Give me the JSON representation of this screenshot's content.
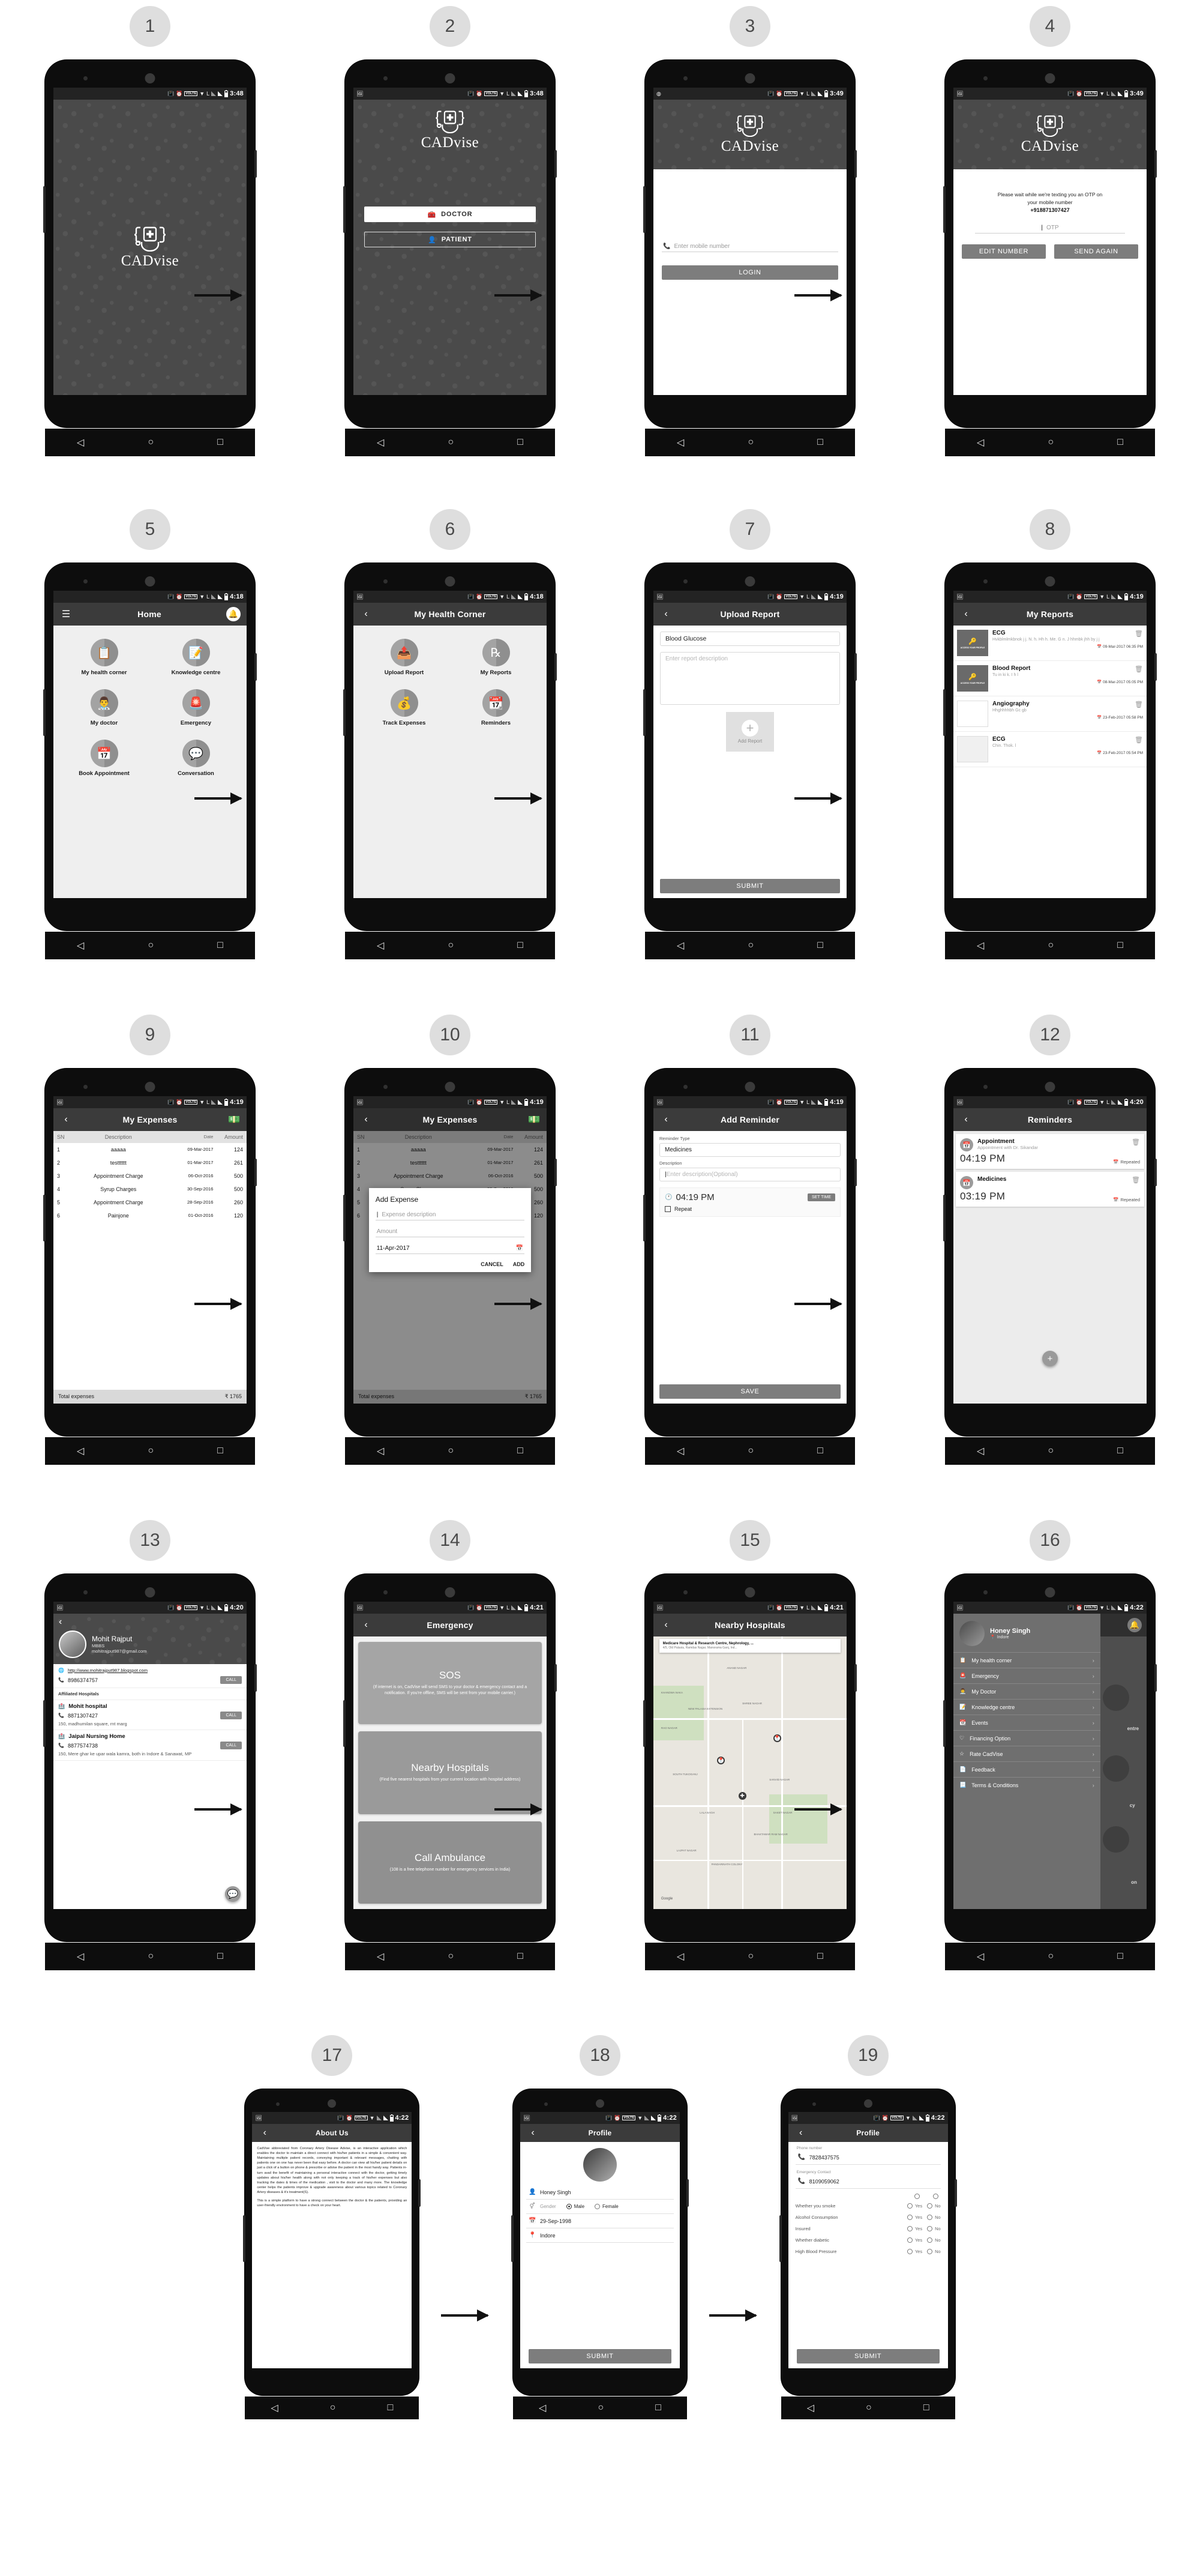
{
  "app": {
    "name": "CADvise",
    "brand_color": "#3b3b3b",
    "accent_grey": "#7d7d7d"
  },
  "steps": [
    "1",
    "2",
    "3",
    "4",
    "5",
    "6",
    "7",
    "8",
    "9",
    "10",
    "11",
    "12",
    "13",
    "14",
    "15",
    "16",
    "17",
    "18",
    "19"
  ],
  "status_bar": {
    "time_348": "3:48",
    "time_349": "3:49",
    "time_418": "4:18",
    "time_419": "4:19",
    "time_420": "4:20",
    "time_421": "4:21",
    "time_422": "4:22",
    "volte": "VOLTE"
  },
  "screen1": {
    "logo_text": "CADvise",
    "time": "3:48"
  },
  "screen2": {
    "time": "3:48",
    "logo_text": "CADvise",
    "doctor_label": "DOCTOR",
    "patient_label": "PATIENT"
  },
  "screen3": {
    "time": "3:49",
    "logo_text": "CADvise",
    "mobile_placeholder": "Enter mobile number",
    "login_label": "LOGIN"
  },
  "screen4": {
    "time": "3:49",
    "logo_text": "CADvise",
    "message_line1": "Please wait while we're texting you an OTP on",
    "message_line2": "your mobile number",
    "phone_number": "+918871307427",
    "otp_placeholder": "OTP",
    "edit_number_label": "EDIT NUMBER",
    "send_again_label": "SEND AGAIN"
  },
  "screen5": {
    "time": "4:18",
    "title": "Home",
    "tiles": [
      {
        "label": "My health corner",
        "icon": "clipboard-heart-icon"
      },
      {
        "label": "Knowledge centre",
        "icon": "document-pencil-icon"
      },
      {
        "label": "My doctor",
        "icon": "doctor-icon"
      },
      {
        "label": "Emergency",
        "icon": "siren-icon"
      },
      {
        "label": "Book Appointment",
        "icon": "calendar-check-icon"
      },
      {
        "label": "Conversation",
        "icon": "chat-bubbles-icon"
      }
    ]
  },
  "screen6": {
    "time": "4:18",
    "title": "My Health Corner",
    "tiles": [
      {
        "label": "Upload Report",
        "icon": "file-upload-icon"
      },
      {
        "label": "My Reports",
        "icon": "prescription-icon"
      },
      {
        "label": "Track Expenses",
        "icon": "money-bag-icon"
      },
      {
        "label": "Reminders",
        "icon": "calendar-icon"
      }
    ]
  },
  "screen7": {
    "time": "4:19",
    "title": "Upload Report",
    "report_type": "Blood Glucose",
    "description_placeholder": "Enter report description",
    "add_report_label": "Add Report",
    "submit_label": "SUBMIT"
  },
  "screen8": {
    "time": "4:19",
    "title": "My Reports",
    "thumb_caption": "ACCESS YOUR PROFILE",
    "thumb_sub": "Lorem ipsum dolor sit er elit lamet, consectetaur cillium adipisicing pecu, sed do eiusmod tempor incididunt ut labore et dolore mag...",
    "reports": [
      {
        "title": "ECG",
        "desc": "Hvkblmlmkbnok j j. N. h. Hh h. Me. G n. J hhmbk jhh by j j",
        "datetime": "09-Mar-2017 06:35 PM",
        "thumb": "dark"
      },
      {
        "title": "Blood Report",
        "desc": "Tu in ki k. I h l",
        "datetime": "08-Mar-2017 05:05 PM",
        "thumb": "dark"
      },
      {
        "title": "Angiography",
        "desc": "Hhghhhhbh Gc gb",
        "datetime": "23-Feb-2017 05:58 PM",
        "thumb": "empty"
      },
      {
        "title": "ECG",
        "desc": "Chin.  Thok. l",
        "datetime": "23-Feb-2017 05:54 PM",
        "thumb": "map"
      }
    ]
  },
  "screen9": {
    "time": "4:19",
    "title": "My Expenses",
    "columns": [
      "SN",
      "Description",
      "Date",
      "Amount"
    ],
    "rows": [
      {
        "sn": "1",
        "desc": "aaaaa",
        "date": "09-Mar-2017",
        "amount": "124"
      },
      {
        "sn": "2",
        "desc": "testttttt",
        "date": "01-Mar-2017",
        "amount": "261"
      },
      {
        "sn": "3",
        "desc": "Appointment Charge",
        "date": "06-Oct-2016",
        "amount": "500"
      },
      {
        "sn": "4",
        "desc": "Syrup Charges",
        "date": "30-Sep-2016",
        "amount": "500"
      },
      {
        "sn": "5",
        "desc": "Appointment Charge",
        "date": "28-Sep-2016",
        "amount": "260"
      },
      {
        "sn": "6",
        "desc": "Painjone",
        "date": "01-Oct-2016",
        "amount": "120"
      }
    ],
    "total_label": "Total expenses",
    "total_value": "₹ 1765"
  },
  "screen10": {
    "time": "4:19",
    "title": "My Expenses",
    "dialog_title": "Add Expense",
    "desc_placeholder": "Expense description",
    "amount_placeholder": "Amount",
    "date_value": "11-Apr-2017",
    "cancel_label": "CANCEL",
    "add_label": "ADD",
    "total_label": "Total expenses",
    "total_value": "₹ 1765"
  },
  "screen11": {
    "time": "4:19",
    "title": "Add Reminder",
    "type_label": "Reminder Type",
    "type_value": "Medicines",
    "description_label": "Description",
    "description_placeholder": "Enter description(Optional)",
    "time_value": "04:19 PM",
    "set_time_label": "SET TIME",
    "repeat_label": "Repeat",
    "save_label": "SAVE"
  },
  "screen12": {
    "time": "4:20",
    "title": "Reminders",
    "reminders": [
      {
        "name": "Appointment",
        "sub": "Appointment with Dr. Sikandar",
        "time": "04:19 PM",
        "repeat": "Repeated"
      },
      {
        "name": "Medicines",
        "sub": "",
        "time": "03:19 PM",
        "repeat": "Repeated"
      }
    ]
  },
  "screen13": {
    "time": "4:20",
    "doctor_name": "Mohit Rajput",
    "degree": "MBBS",
    "email": "mohitrajput987@gmail.com",
    "website": "http://www.mohitrajput987.blogspot.com",
    "phone": "8986374757",
    "call_label": "CALL",
    "affiliated_label": "Affiliated Hospitals",
    "hospitals": [
      {
        "name": "Mohit hospital",
        "phone": "8871307427",
        "address": "150, madhumilan square, rnt marg",
        "call_label": "CALL"
      },
      {
        "name": "Jaipal Nursing Home",
        "phone": "8877574738",
        "address": "150, Mere ghar ke upar wala kamra, both in Indore & Sanawat, MP",
        "call_label": "CALL"
      }
    ]
  },
  "screen14": {
    "time": "4:21",
    "title": "Emergency",
    "cards": [
      {
        "title": "SOS",
        "desc": "(If internet is on, CadVise will send SMS to your doctor & emergency contact and a notification. If you're offline, SMS will be sent from your mobile carrier.)"
      },
      {
        "title": "Nearby Hospitals",
        "desc": "(Find five nearest hospitals from your current location with hospital address)"
      },
      {
        "title": "Call Ambulance",
        "desc": "(108 is a free telephone number for emergency services in India)"
      }
    ]
  },
  "screen15": {
    "time": "4:21",
    "title": "Nearby Hospitals",
    "hospital_name": "Medicare Hospital & Research Centre, Nephrology, ...",
    "hospital_addr": "4/5, Old Palasia, Ramdas Nagar, Manorama Ganj, Ind...",
    "map_labels": [
      "ANAND NAGAR",
      "KHANDWA NAKA",
      "NEW PALASIA EXTENSION",
      "SHREE NAGAR",
      "RAO NAGAR",
      "SANVID NAGAR",
      "SAKET NAGAR",
      "BHAKTAWAR RAM NAGAR",
      "LALA BAGH",
      "SOUTH TUKOGANJ",
      "PANDARINATH COLONY",
      "LAJPAT NAGAR",
      "Google"
    ]
  },
  "screen16": {
    "time": "4:22",
    "user_name": "Honey Singh",
    "user_location": "Indore",
    "items": [
      {
        "label": "My health corner",
        "icon": "clipboard-icon"
      },
      {
        "label": "Emergency",
        "icon": "siren-icon"
      },
      {
        "label": "My Doctor",
        "icon": "doctor-icon"
      },
      {
        "label": "Knowledge centre",
        "icon": "document-pencil-icon"
      },
      {
        "label": "Events",
        "icon": "calendar-icon"
      },
      {
        "label": "Financing Option",
        "icon": "heart-icon"
      },
      {
        "label": "Rate CadVise",
        "icon": "star-icon"
      },
      {
        "label": "Feedback",
        "icon": "feedback-icon"
      },
      {
        "label": "Terms & Conditions",
        "icon": "doc-icon"
      }
    ],
    "behind_labels": [
      "entre",
      "cy",
      "on"
    ]
  },
  "screen17": {
    "time": "4:22",
    "title": "About Us",
    "paragraphs": [
      "CadVise abbreviated from Coronary Artery Disease Advise, is an interactive application which enables the doctor to maintain a direct connect with his/her patients in a simple & convenient way. Maintaining multiple patient records, conveying important & relevant messages, chatting with patients one on one has never been that easy before. A doctor can view all his/her patient details on just a click of a button on phone & prescribe or advise the patient in the most handy way. Patients in-turn avail the benefit of maintaining a personal interactive connect with the doctor, getting timely updates about his/her health along with not only keeping a track of his/her expenses but also tracking the dates & times of the medication , visit to the doctor and many more. The knowledge center helps the patients improve & upgrade awareness about various topics related to Coronary Artery diseases & it's treatment(S).",
      "This is a simple platform to have a strong connect between the doctor & the patients, providing an user-friendly environment to have a check on your heart."
    ]
  },
  "screen18": {
    "time": "4:22",
    "title": "Profile",
    "name_value": "Honey Singh",
    "gender_label": "Gender",
    "gender_male": "Male",
    "gender_female": "Female",
    "dob_value": "29-Sep-1998",
    "city_value": "Indore",
    "submit_label": "SUBMIT"
  },
  "screen19": {
    "time": "4:22",
    "title": "Profile",
    "phone_label": "Phone number",
    "phone_value": "7828437575",
    "emergency_label": "Emergency Contact",
    "emergency_value": "8109059062",
    "questions": [
      {
        "q": "Whether you smoke",
        "yes": "Yes",
        "no": "No"
      },
      {
        "q": "Alcohol Consumption",
        "yes": "Yes",
        "no": "No"
      },
      {
        "q": "Insured",
        "yes": "Yes",
        "no": "No"
      },
      {
        "q": "Whether diabetic",
        "yes": "Yes",
        "no": "No"
      },
      {
        "q": "High Blood Pressure",
        "yes": "Yes",
        "no": "No"
      }
    ],
    "submit_label": "SUBMIT"
  }
}
